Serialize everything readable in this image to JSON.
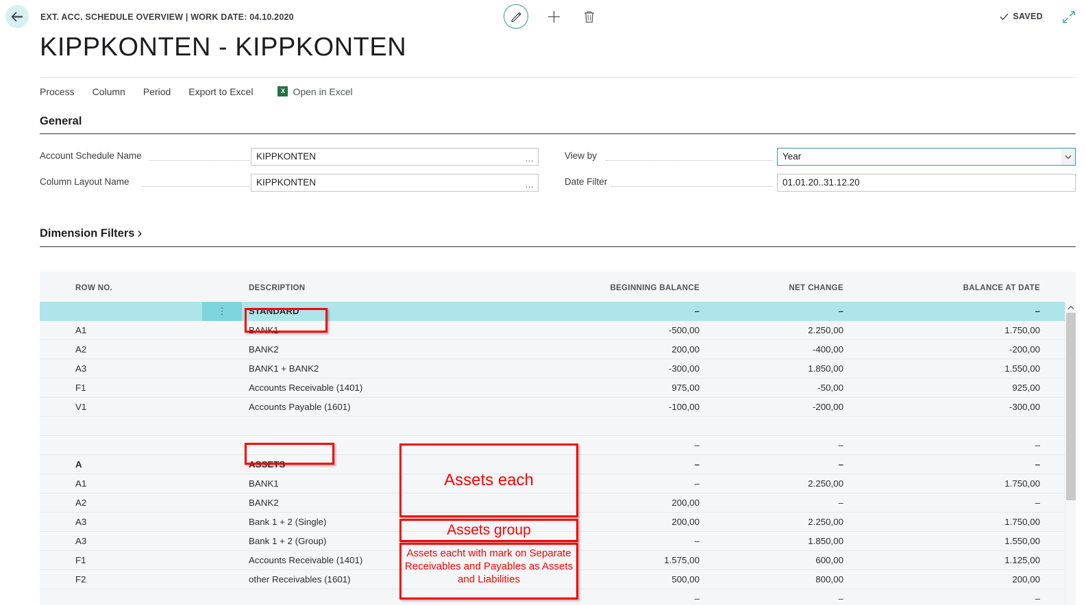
{
  "topbar": {
    "back_icon": "arrow-left-icon",
    "breadcrumb": "EXT. ACC. SCHEDULE OVERVIEW | WORK DATE: 04.10.2020",
    "edit_icon": "pencil-icon",
    "new_icon": "plus-icon",
    "delete_icon": "trash-icon",
    "saved_label": "SAVED",
    "saved_check_icon": "check-icon",
    "expand_icon": "expand-collapse-icon"
  },
  "page_title": "KIPPKONTEN - KIPPKONTEN",
  "actions": [
    {
      "label": "Process"
    },
    {
      "label": "Column"
    },
    {
      "label": "Period"
    },
    {
      "label": "Export to Excel"
    }
  ],
  "excel": {
    "glyph": "X",
    "label": "Open in Excel",
    "icon": "excel-icon"
  },
  "general": {
    "title": "General",
    "fields": [
      {
        "label": "Account Schedule Name",
        "value": "KIPPKONTEN",
        "assist": "…"
      },
      {
        "label": "Column Layout Name",
        "value": "KIPPKONTEN",
        "assist": "…"
      },
      {
        "label": "View by",
        "value": "Year",
        "dropdown_icon": "chevron-down-icon"
      },
      {
        "label": "Date Filter",
        "value": "01.01.20..31.12.20"
      }
    ]
  },
  "dimension_filters": {
    "title": "Dimension Filters",
    "chevron": "›"
  },
  "grid": {
    "columns": [
      {
        "key": "row_no",
        "label": "ROW NO."
      },
      {
        "key": "description",
        "label": "DESCRIPTION"
      },
      {
        "key": "beginning_balance",
        "label": "BEGINNING BALANCE"
      },
      {
        "key": "net_change",
        "label": "NET CHANGE"
      },
      {
        "key": "balance_at_date",
        "label": "BALANCE AT DATE"
      }
    ],
    "rows": [
      {
        "row_no": "",
        "description": "STANDARD",
        "beginning_balance": "–",
        "net_change": "–",
        "balance_at_date": "–",
        "selected": true,
        "bold": true
      },
      {
        "row_no": "A1",
        "description": "BANK1",
        "beginning_balance": "-500,00",
        "net_change": "2.250,00",
        "balance_at_date": "1.750,00"
      },
      {
        "row_no": "A2",
        "description": "BANK2",
        "beginning_balance": "200,00",
        "net_change": "-400,00",
        "balance_at_date": "-200,00"
      },
      {
        "row_no": "A3",
        "description": "BANK1 + BANK2",
        "beginning_balance": "-300,00",
        "net_change": "1.850,00",
        "balance_at_date": "1.550,00"
      },
      {
        "row_no": "F1",
        "description": "Accounts Receivable (1401)",
        "beginning_balance": "975,00",
        "net_change": "-50,00",
        "balance_at_date": "925,00"
      },
      {
        "row_no": "V1",
        "description": "Accounts Payable (1601)",
        "beginning_balance": "-100,00",
        "net_change": "-200,00",
        "balance_at_date": "-300,00"
      },
      {
        "row_no": "",
        "description": "",
        "beginning_balance": "",
        "net_change": "",
        "balance_at_date": ""
      },
      {
        "row_no": "",
        "description": "",
        "beginning_balance": "–",
        "net_change": "–",
        "balance_at_date": "–"
      },
      {
        "row_no": "A",
        "description": "ASSETS",
        "beginning_balance": "–",
        "net_change": "–",
        "balance_at_date": "–",
        "bold": true
      },
      {
        "row_no": "A1",
        "description": "BANK1",
        "beginning_balance": "–",
        "net_change": "2.250,00",
        "balance_at_date": "1.750,00"
      },
      {
        "row_no": "A2",
        "description": "BANK2",
        "beginning_balance": "200,00",
        "net_change": "–",
        "balance_at_date": "–"
      },
      {
        "row_no": "A3",
        "description": "Bank 1 + 2 (Single)",
        "beginning_balance": "200,00",
        "net_change": "2.250,00",
        "balance_at_date": "1.750,00"
      },
      {
        "row_no": "A3",
        "description": "Bank 1 + 2 (Group)",
        "beginning_balance": "–",
        "net_change": "1.850,00",
        "balance_at_date": "1.550,00"
      },
      {
        "row_no": "F1",
        "description": "Accounts Receivable (1401)",
        "beginning_balance": "1.575,00",
        "net_change": "600,00",
        "balance_at_date": "1.125,00"
      },
      {
        "row_no": "F2",
        "description": "other Receivables (1601)",
        "beginning_balance": "500,00",
        "net_change": "800,00",
        "balance_at_date": "200,00"
      },
      {
        "row_no": "",
        "description": "",
        "beginning_balance": "–",
        "net_change": "–",
        "balance_at_date": "–"
      }
    ]
  },
  "annotations": [
    {
      "id": "standard",
      "text": ""
    },
    {
      "id": "assets",
      "text": ""
    },
    {
      "id": "each",
      "text": "Assets each"
    },
    {
      "id": "group",
      "text": "Assets group"
    },
    {
      "id": "mark",
      "text": "Assets eacht with mark on Separate Receivables and Payables as Assets and Liabilities"
    }
  ],
  "colors": {
    "accent": "#2e9aa3",
    "selected_row": "#ade5ea",
    "annotation": "#ff0000",
    "grid_bg": "#f5f6f7",
    "excel_green": "#217346"
  }
}
